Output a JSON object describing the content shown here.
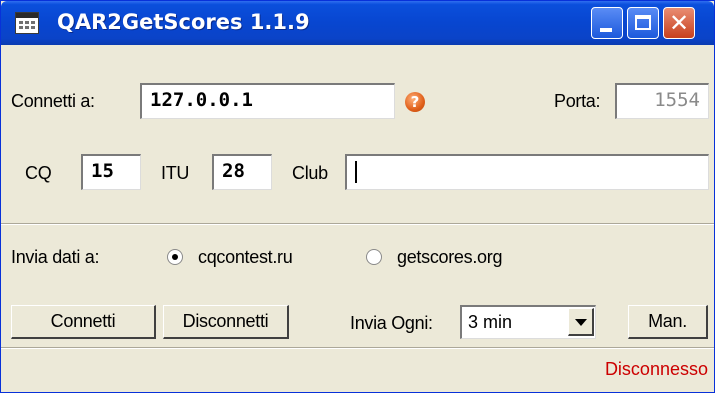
{
  "window": {
    "title": "QAR2GetScores 1.1.9",
    "close_glyph": "✕"
  },
  "connection": {
    "connect_label": "Connetti a:",
    "host": "127.0.0.1",
    "help_glyph": "?",
    "port_label": "Porta:",
    "port": "1554"
  },
  "station": {
    "cq_label": "CQ",
    "cq": "15",
    "itu_label": "ITU",
    "itu": "28",
    "club_label": "Club",
    "club": ""
  },
  "send": {
    "label": "Invia dati a:",
    "options": [
      {
        "label": "cqcontest.ru",
        "selected": true
      },
      {
        "label": "getscores.org",
        "selected": false
      }
    ]
  },
  "actions": {
    "connect": "Connetti",
    "disconnect": "Disconnetti",
    "interval_label": "Invia Ogni:",
    "interval": "3 min",
    "manual": "Man."
  },
  "status": {
    "text": "Disconnesso",
    "color": "#cc0000"
  },
  "colors": {
    "titlebar": "#0846d0",
    "window_bg": "#ece9d8",
    "close_button": "#c7401e"
  },
  "icons": [
    "app-icon",
    "help-icon",
    "minimize-icon",
    "maximize-icon",
    "close-icon",
    "chevron-down-icon"
  ]
}
